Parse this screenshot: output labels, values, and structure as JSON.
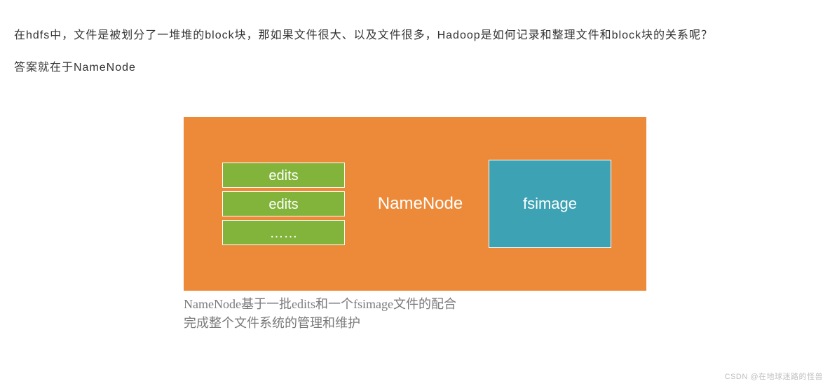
{
  "intro": {
    "line1": "在hdfs中，文件是被划分了一堆堆的block块，那如果文件很大、以及文件很多，Hadoop是如何记录和整理文件和block块的关系呢？",
    "line2": "答案就在于NameNode"
  },
  "diagram": {
    "edits": [
      "edits",
      "edits",
      "……"
    ],
    "center": "NameNode",
    "right": "fsimage"
  },
  "caption": {
    "l1": "NameNode基于一批edits和一个fsimage文件的配合",
    "l2": "完成整个文件系统的管理和维护"
  },
  "watermark": "CSDN @在地球迷路的怪兽"
}
